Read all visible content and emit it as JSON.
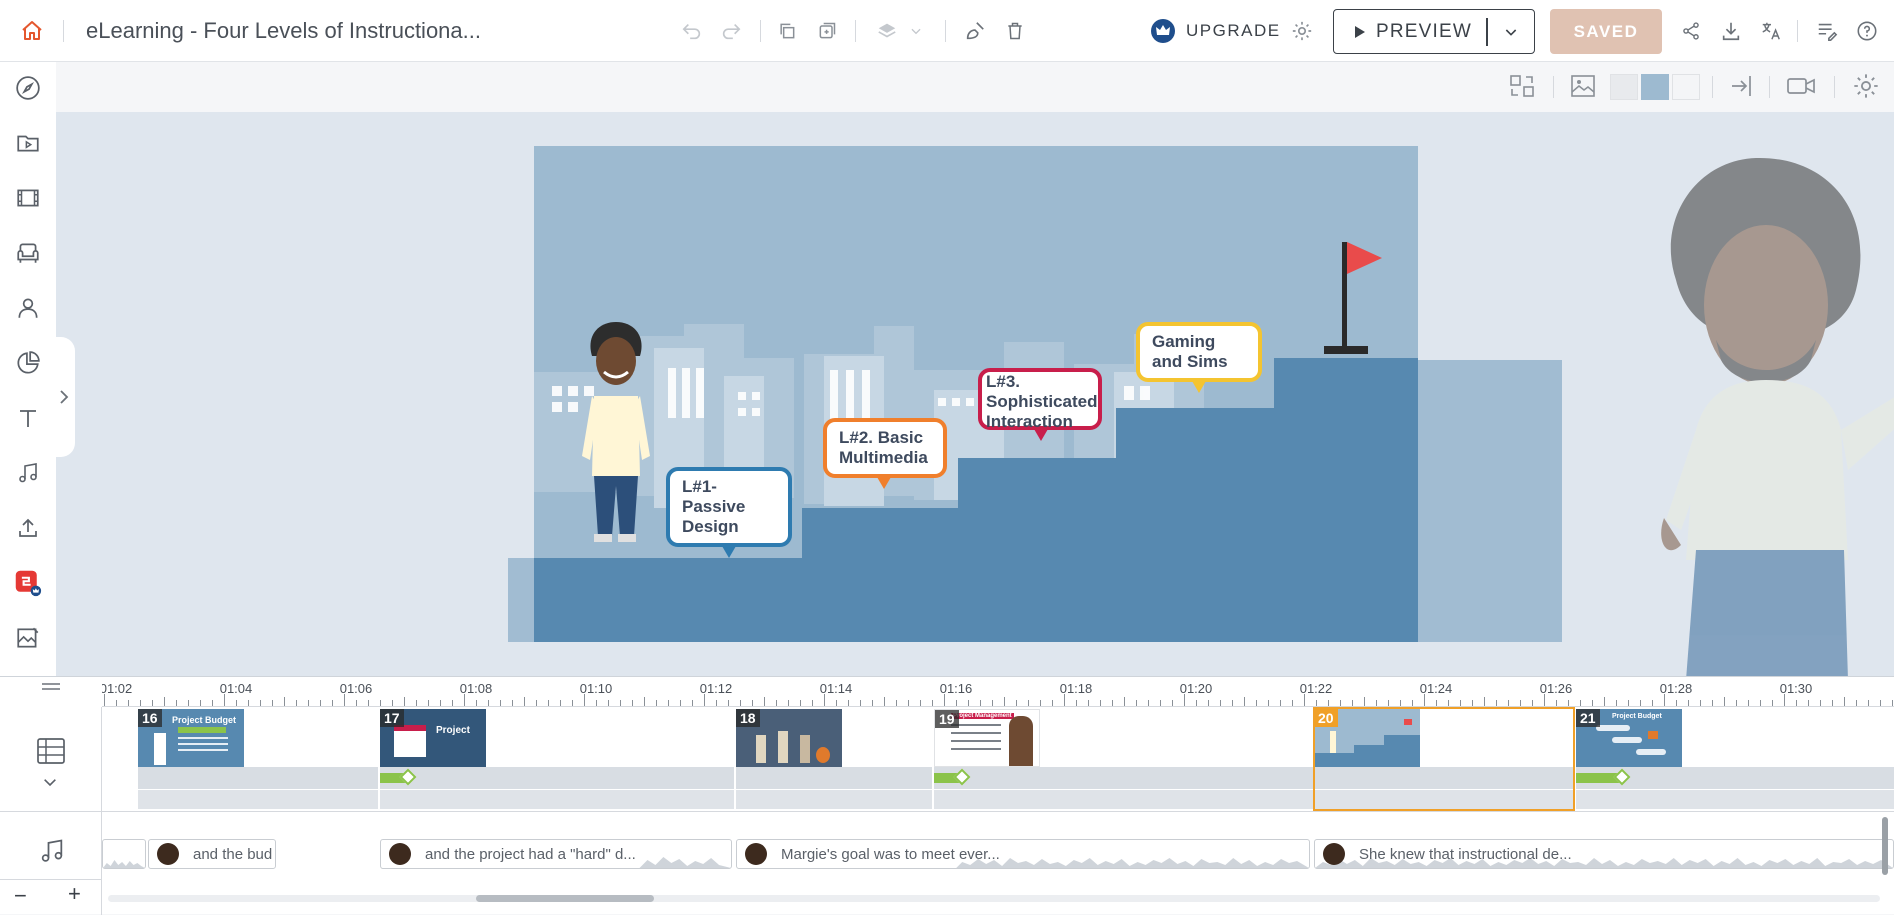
{
  "app": {
    "doc_title": "eLearning - Four Levels of Instructiona...",
    "upgrade_label": "UPGRADE",
    "preview_label": "PREVIEW",
    "saved_label": "SAVED",
    "colors": {
      "accent": "#1f4e8c",
      "saved_bg": "#e0c2b2",
      "home_icon": "#e4572e",
      "brand_red": "#e53935"
    }
  },
  "topbar_icons": [
    "home-icon",
    "undo-icon",
    "redo-icon",
    "copy-icon",
    "duplicate-icon",
    "layers-icon",
    "chevron-down-icon",
    "clean-icon",
    "trash-icon",
    "crown-icon",
    "gear-icon",
    "play-icon",
    "chevron-down-icon",
    "share-icon",
    "download-icon",
    "translate-icon",
    "notes-icon",
    "help-icon"
  ],
  "sidebar_icons": [
    "compass-icon",
    "media-library-icon",
    "video-icon",
    "furniture-icon",
    "character-icon",
    "chart-icon",
    "text-icon",
    "music-icon",
    "upload-icon",
    "brand-plugin-icon",
    "image-edit-icon"
  ],
  "toolbar2_icons": [
    "swap-layout-icon",
    "image-icon",
    "swatch-light-icon",
    "swatch-blue-icon",
    "swatch-white-icon",
    "exit-icon",
    "camera-icon",
    "gear-icon"
  ],
  "slide": {
    "bubbles": [
      {
        "text": "L#1-Passive Design",
        "color": "#2e7bb0"
      },
      {
        "text": "L#2. Basic Multimedia",
        "color": "#f07f2c"
      },
      {
        "text": "L#3. Sophisticated Interaction",
        "color": "#c81e4b"
      },
      {
        "text": "Gaming and Sims",
        "color": "#f4c430"
      }
    ],
    "colors": {
      "sky": "#9dbad0",
      "stairs": "#5789b0",
      "flag": "#e94b4b"
    }
  },
  "timeline": {
    "ticks": [
      "01:02",
      "01:04",
      "01:06",
      "01:08",
      "01:10",
      "01:12",
      "01:14",
      "01:16",
      "01:18",
      "01:20",
      "01:22",
      "01:24",
      "01:26",
      "01:28",
      "01:30"
    ],
    "scenes": [
      {
        "num": "16",
        "title": "Project Budget"
      },
      {
        "num": "17",
        "title": "Project"
      },
      {
        "num": "18",
        "title": ""
      },
      {
        "num": "19",
        "title": "Project Management"
      },
      {
        "num": "20",
        "title": ""
      },
      {
        "num": "21",
        "title": "Project Budget"
      }
    ],
    "audio_clips": [
      {
        "text": "and the bud"
      },
      {
        "text": "and the project had a \"hard\" d..."
      },
      {
        "text": "Margie's goal was to meet ever..."
      },
      {
        "text": "She knew that instructional de..."
      }
    ],
    "zoom_out_label": "−",
    "zoom_in_label": "+"
  }
}
